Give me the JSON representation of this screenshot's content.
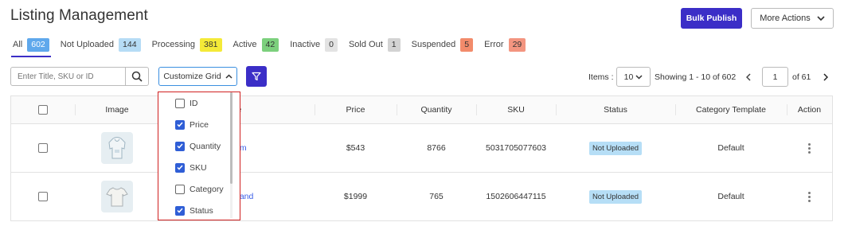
{
  "header": {
    "title": "Listing Management",
    "bulk_publish": "Bulk Publish",
    "more_actions": "More Actions"
  },
  "tabs": [
    {
      "label": "All",
      "count": "602",
      "color": "#5fa8ec"
    },
    {
      "label": "Not Uploaded",
      "count": "144",
      "color": "#b6dcf5"
    },
    {
      "label": "Processing",
      "count": "381",
      "color": "#f4ea38"
    },
    {
      "label": "Active",
      "count": "42",
      "color": "#7cd07d"
    },
    {
      "label": "Inactive",
      "count": "0",
      "color": "#e3e3e3"
    },
    {
      "label": "Sold Out",
      "count": "1",
      "color": "#d3d3d3"
    },
    {
      "label": "Suspended",
      "count": "5",
      "color": "#f28b6b"
    },
    {
      "label": "Error",
      "count": "29",
      "color": "#f39580"
    }
  ],
  "toolbar": {
    "search_placeholder": "Enter Title, SKU or ID",
    "customize_grid": "Customize Grid",
    "items_label": "Items :",
    "items_value": "10",
    "showing": "Showing 1 - 10 of 602",
    "page_value": "1",
    "of_pages": "of 61"
  },
  "table": {
    "columns": {
      "image": "Image",
      "title_partial": "le",
      "price": "Price",
      "quantity": "Quantity",
      "sku": "SKU",
      "status": "Status",
      "category": "Category Template",
      "action": "Action"
    },
    "rows": [
      {
        "title_partial": "am",
        "price": "$543",
        "quantity": "8766",
        "sku": "5031705077603",
        "status": "Not Uploaded",
        "category": "Default",
        "icon": "hoodie-icon"
      },
      {
        "title_partial": "band",
        "price": "$1999",
        "quantity": "765",
        "sku": "1502606447115",
        "status": "Not Uploaded",
        "category": "Default",
        "icon": "tshirt-icon"
      }
    ]
  },
  "customize_menu": {
    "items": [
      {
        "label": "ID",
        "checked": false
      },
      {
        "label": "Price",
        "checked": true
      },
      {
        "label": "Quantity",
        "checked": true
      },
      {
        "label": "SKU",
        "checked": true
      },
      {
        "label": "Category",
        "checked": false
      },
      {
        "label": "Status",
        "checked": true
      }
    ]
  },
  "colors": {
    "primary": "#3b2ec7",
    "status_badge": "#b6def6",
    "highlight_border": "#d02020"
  }
}
